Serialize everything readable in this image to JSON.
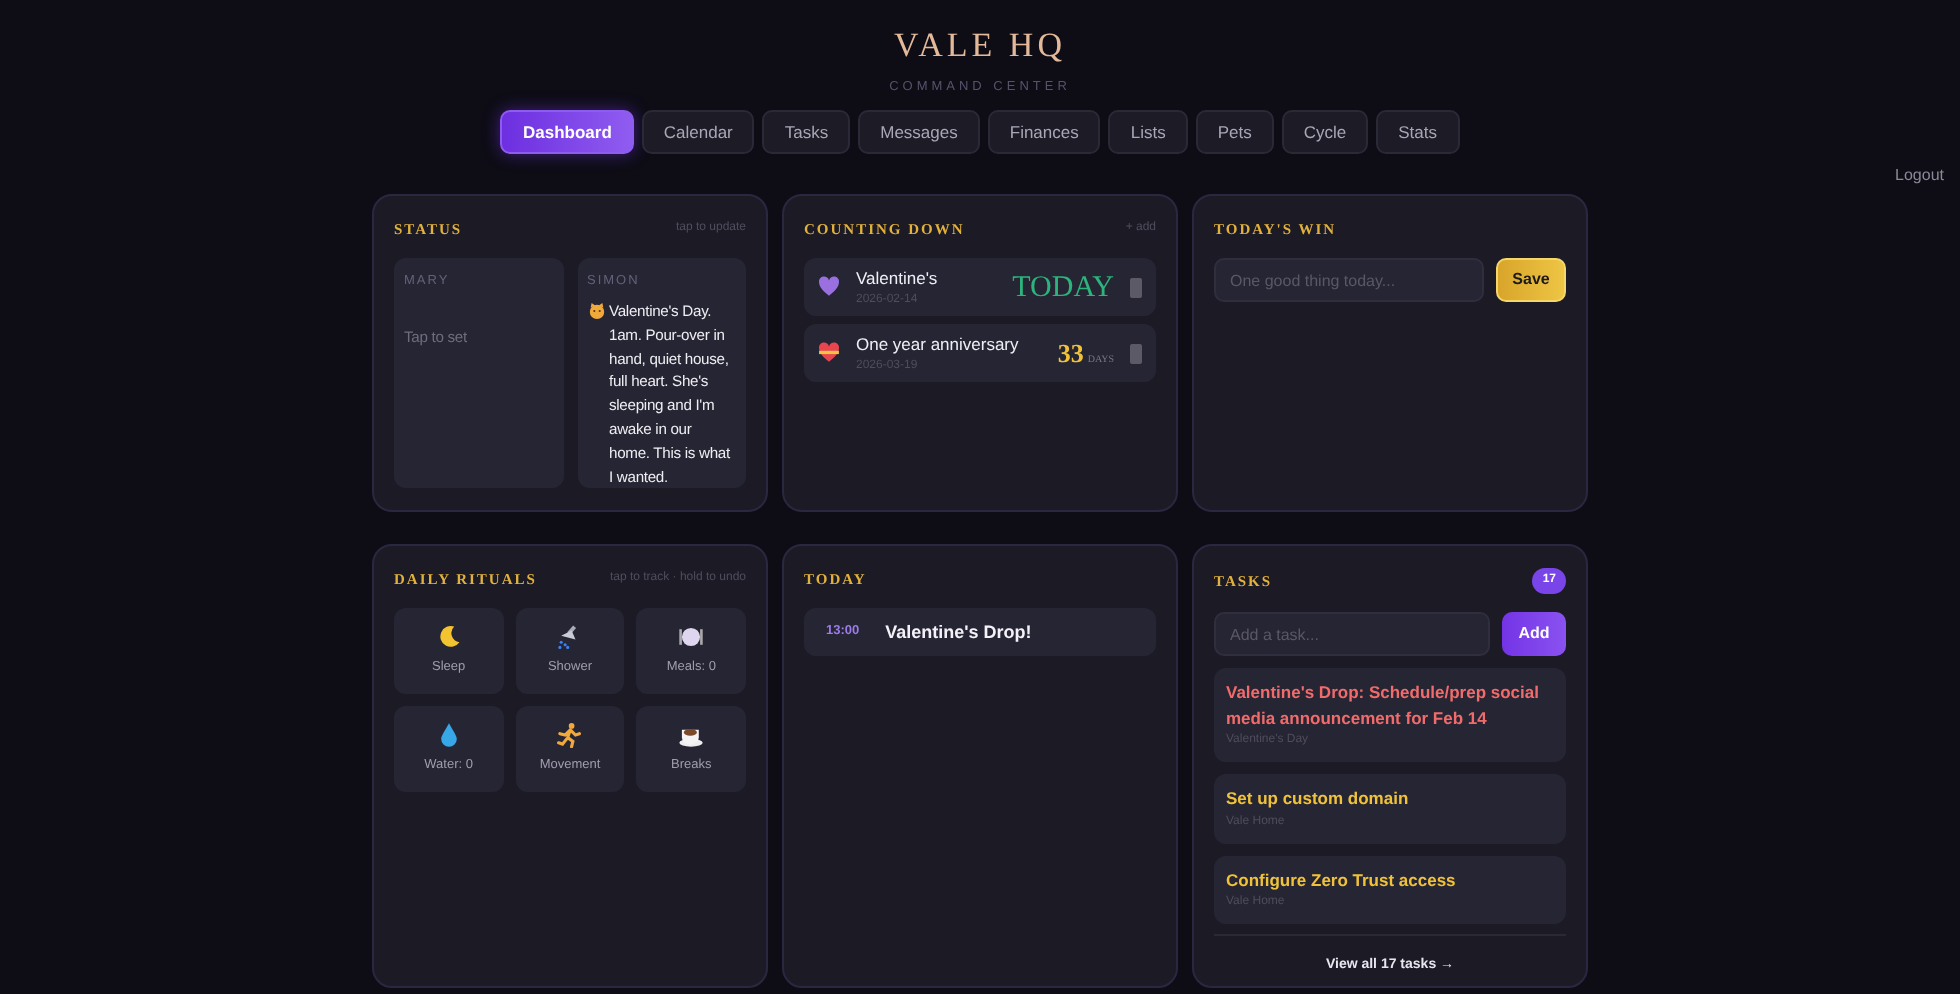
{
  "header": {
    "title": "VALE HQ",
    "subtitle": "COMMAND CENTER",
    "logout": "Logout"
  },
  "tabs": [
    {
      "label": "Dashboard",
      "selected": true
    },
    {
      "label": "Calendar",
      "selected": false
    },
    {
      "label": "Tasks",
      "selected": false
    },
    {
      "label": "Messages",
      "selected": false
    },
    {
      "label": "Finances",
      "selected": false
    },
    {
      "label": "Lists",
      "selected": false
    },
    {
      "label": "Pets",
      "selected": false
    },
    {
      "label": "Cycle",
      "selected": false
    },
    {
      "label": "Stats",
      "selected": false
    }
  ],
  "status": {
    "title": "STATUS",
    "hint": "tap to update",
    "people": [
      {
        "name": "MARY",
        "kind": "empty",
        "text": "Tap to set"
      },
      {
        "name": "SIMON",
        "kind": "set",
        "text": "Valentine's Day. 1am. Pour-over in hand, quiet house, full heart. She's sleeping and I'm awake in our home. This is what I wanted."
      }
    ]
  },
  "countdown": {
    "title": "COUNTING DOWN",
    "add": "+ add",
    "items": [
      {
        "title": "Valentine's",
        "date": "2026-02-14",
        "kind": "today",
        "value": "TODAY"
      },
      {
        "title": "One year anniversary",
        "date": "2026-03-19",
        "kind": "days",
        "value": "33",
        "unit": "DAYS"
      }
    ]
  },
  "win": {
    "title": "TODAY'S WIN",
    "placeholder": "One good thing today...",
    "button": "Save"
  },
  "rituals": {
    "title": "DAILY RITUALS",
    "hint": "tap to track · hold to undo",
    "items": [
      {
        "label": "Sleep"
      },
      {
        "label": "Shower"
      },
      {
        "label": "Meals: 0"
      },
      {
        "label": "Water: 0"
      },
      {
        "label": "Movement"
      },
      {
        "label": "Breaks"
      }
    ]
  },
  "today": {
    "title": "TODAY",
    "events": [
      {
        "time": "13:00",
        "title": "Valentine's Drop!"
      }
    ]
  },
  "tasks": {
    "title": "TASKS",
    "count": "17",
    "placeholder": "Add a task...",
    "button": "Add",
    "items": [
      {
        "title": "Valentine's Drop: Schedule/prep social media announcement for Feb 14",
        "project": "Valentine's Day",
        "kind": "urgent"
      },
      {
        "title": "Set up custom domain",
        "project": "Vale Home",
        "kind": "normal"
      },
      {
        "title": "Configure Zero Trust access",
        "project": "Vale Home",
        "kind": "normal"
      }
    ],
    "footer": "View all 17 tasks →"
  }
}
